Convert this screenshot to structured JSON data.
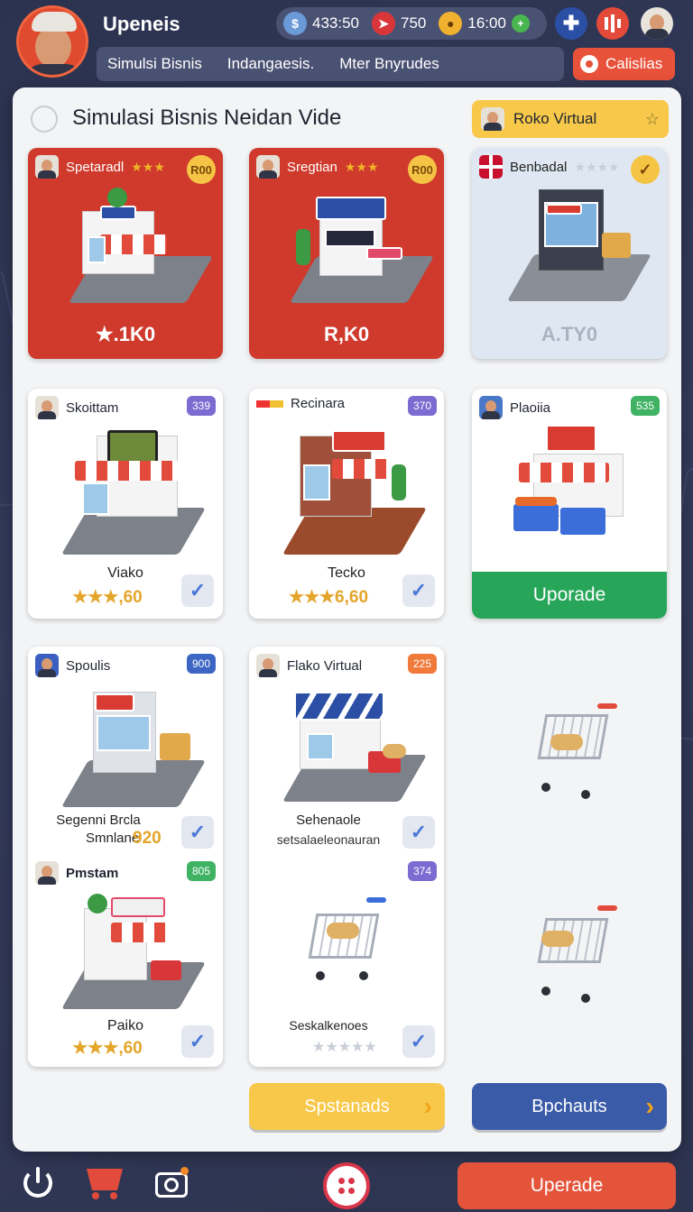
{
  "header": {
    "player_name": "Upeneis",
    "resources": [
      {
        "icon": "coins-icon",
        "value": "433:50"
      },
      {
        "icon": "rocket-icon",
        "value": "750"
      },
      {
        "icon": "gold-icon",
        "value": "16:00"
      }
    ],
    "tabs": [
      "Simulsi Bisnis",
      "Indangaesis.",
      "Mter Bnyrudes"
    ],
    "cta_label": "Calislias"
  },
  "panel": {
    "title": "Simulasi Bisnis Neidan Vide",
    "featured_label": "Roko Virtual"
  },
  "cards": [
    {
      "name": "Spetaradl",
      "coin": "R00",
      "price": "★.1K0"
    },
    {
      "name": "Sregtian",
      "coin": "R00",
      "price": "R,K0"
    },
    {
      "name": "Benbadal",
      "price": "A.TY0"
    },
    {
      "name": "Skoittam",
      "badge": "339",
      "title": "Viako",
      "value": "★★★,60"
    },
    {
      "name": "Recinara",
      "badge": "370",
      "title": "Tecko",
      "value": "★★★6,60"
    },
    {
      "name": "Plaoiia",
      "badge": "535",
      "button": "Uporade"
    },
    {
      "name": "Spoulis",
      "badge": "900",
      "title": "Segenni Brcla",
      "subtitle": "Smnlane",
      "value": "920"
    },
    {
      "name": "Flako Virtual",
      "badge": "225",
      "title": "Sehenaole",
      "subtitle": "setsalaeleonauran"
    },
    {
      "name": "Pmstam",
      "badge": "805",
      "title": "Paiko",
      "value": "★★★,60"
    },
    {
      "badge": "374",
      "title": "Seskalkenoes"
    }
  ],
  "buttons": {
    "yellow": "Spstanads",
    "blue": "Bpchauts",
    "bottom_upgrade": "Uperade"
  },
  "colors": {
    "red": "#cf3a2c",
    "green": "#27a659",
    "yellow": "#f7c84a",
    "blue": "#3a5ba8",
    "orange": "#e4543b"
  }
}
